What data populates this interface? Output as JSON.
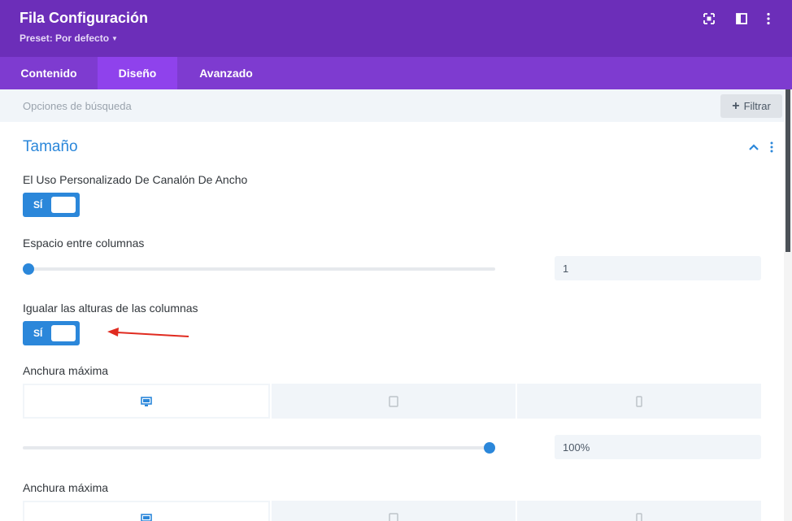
{
  "header": {
    "title": "Fila Configuración",
    "preset_label": "Preset: Por defecto",
    "icons": [
      "fullscreen-icon",
      "split-view-icon",
      "more-vertical-icon"
    ]
  },
  "tabs": [
    {
      "label": "Contenido",
      "active": false
    },
    {
      "label": "Diseño",
      "active": true
    },
    {
      "label": "Avanzado",
      "active": false
    }
  ],
  "search": {
    "placeholder": "Opciones de búsqueda",
    "filter_label": "Filtrar"
  },
  "section": {
    "title": "Tamaño",
    "expanded": true
  },
  "settings": {
    "custom_gutter": {
      "label": "El Uso Personalizado De Canalón De Ancho",
      "toggle_text": "SÍ",
      "on": true
    },
    "gutter_width": {
      "label": "Espacio entre columnas",
      "value": "1",
      "slider_fraction": 0.0
    },
    "equal_heights": {
      "label": "Igualar las alturas de las columnas",
      "toggle_text": "SÍ",
      "on": true
    },
    "max_width_1": {
      "label": "Anchura máxima",
      "value": "100%",
      "slider_fraction": 1.0,
      "devices": [
        "desktop-icon",
        "tablet-icon",
        "phone-icon"
      ],
      "active_device": "desktop-icon"
    },
    "max_width_2": {
      "label": "Anchura máxima",
      "devices": [
        "desktop-icon",
        "tablet-icon",
        "phone-icon"
      ],
      "active_device": "desktop-icon"
    }
  },
  "colors": {
    "header": "#6c2eb9",
    "tabs": "#7e3bd0",
    "active_tab": "#8f42ec",
    "accent": "#2b87da",
    "annotation_arrow": "#e02b20"
  }
}
